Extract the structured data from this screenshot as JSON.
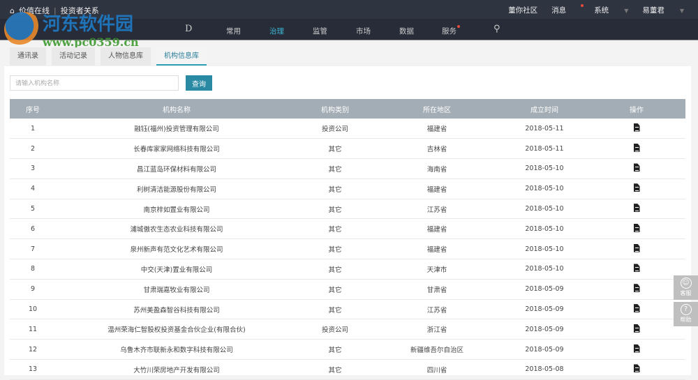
{
  "header": {
    "brand": "价值在线",
    "subtitle": "投资者关系",
    "right": [
      "董你社区",
      "消息",
      "系统",
      "易董君"
    ]
  },
  "nav": {
    "logo": "D",
    "items": [
      "常用",
      "治理",
      "监管",
      "市场",
      "数据",
      "服务"
    ],
    "active": "治理"
  },
  "tabs": [
    "通讯录",
    "活动记录",
    "人物信息库",
    "机构信息库"
  ],
  "active_tab": "机构信息库",
  "search": {
    "placeholder": "请输入机构名称",
    "button": "查询"
  },
  "table": {
    "headers": [
      "序号",
      "机构名称",
      "机构类别",
      "所在地区",
      "成立时间",
      "操作"
    ],
    "rows": [
      [
        "1",
        "融钰(福州)投资管理有限公司",
        "投资公司",
        "福建省",
        "2018-05-11"
      ],
      [
        "2",
        "长春库家家网络科技有限公司",
        "其它",
        "吉林省",
        "2018-05-11"
      ],
      [
        "3",
        "昌江蓝岛环保材料有限公司",
        "其它",
        "海南省",
        "2018-05-10"
      ],
      [
        "4",
        "利树清洁能源股份有限公司",
        "其它",
        "福建省",
        "2018-05-10"
      ],
      [
        "5",
        "南京梓如置业有限公司",
        "其它",
        "江苏省",
        "2018-05-10"
      ],
      [
        "6",
        "浦城傲农生态农业科技有限公司",
        "其它",
        "福建省",
        "2018-05-10"
      ],
      [
        "7",
        "泉州新声有范文化艺术有限公司",
        "其它",
        "福建省",
        "2018-05-10"
      ],
      [
        "8",
        "中交(天津)置业有限公司",
        "其它",
        "天津市",
        "2018-05-10"
      ],
      [
        "9",
        "甘肃瑞嘉牧业有限公司",
        "其它",
        "甘肃省",
        "2018-05-09"
      ],
      [
        "10",
        "苏州美盈森智谷科技有限公司",
        "其它",
        "江苏省",
        "2018-05-09"
      ],
      [
        "11",
        "温州荣海仁智股权投资基金合伙企业(有限合伙)",
        "投资公司",
        "浙江省",
        "2018-05-09"
      ],
      [
        "12",
        "乌鲁木齐市联新永和数字科技有限公司",
        "其它",
        "新疆维吾尔自治区",
        "2018-05-09"
      ],
      [
        "13",
        "大竹川荣房地产开发有限公司",
        "其它",
        "四川省",
        "2018-05-08"
      ]
    ]
  },
  "float": {
    "service": "客服",
    "help": "帮助"
  },
  "watermark": {
    "name": "河东软件园",
    "url": "www.pc0359.cn"
  }
}
